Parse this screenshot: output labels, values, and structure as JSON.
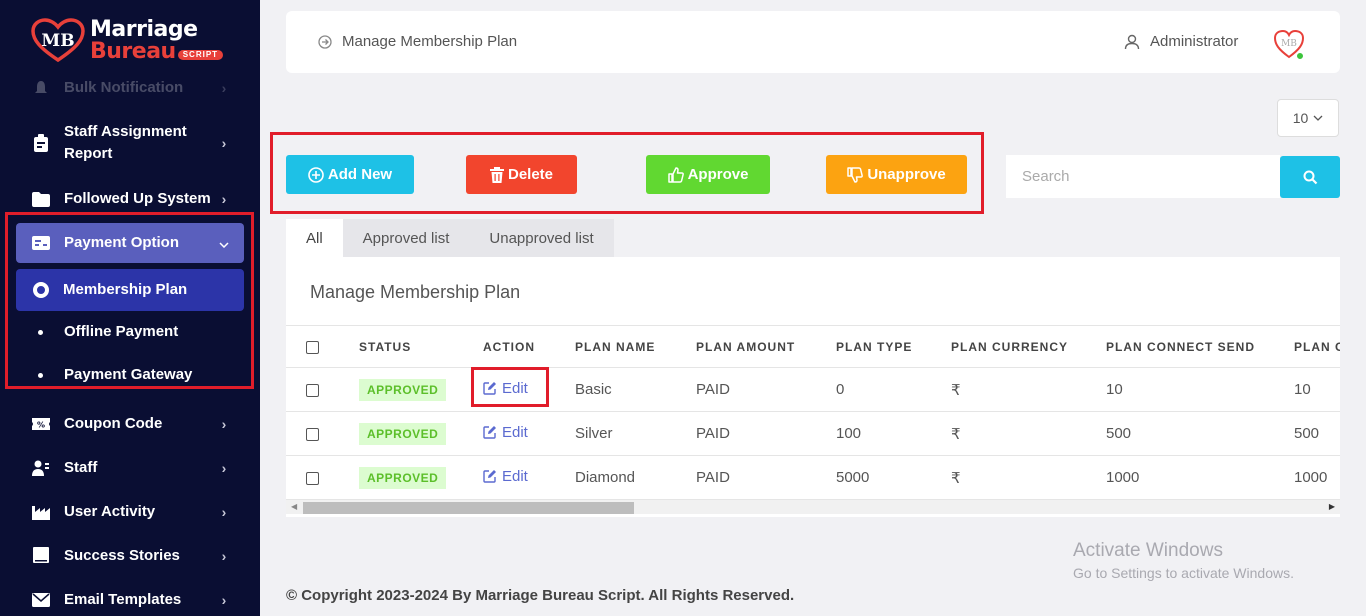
{
  "logo": {
    "line1": "Marriage",
    "line2": "Bureau",
    "tag": "SCRIPT",
    "mark": "MB"
  },
  "sidebar": {
    "items": [
      {
        "label": "Bulk Notification",
        "icon": "bell-icon"
      },
      {
        "label": "Staff Assignment Report",
        "icon": "clipboard-icon"
      },
      {
        "label": "Followed Up System",
        "icon": "folder-icon"
      },
      {
        "label": "Payment Option",
        "icon": "card-icon"
      },
      {
        "label": "Membership Plan",
        "icon": "radio-icon"
      },
      {
        "label": "Offline Payment",
        "icon": "dot-icon"
      },
      {
        "label": "Payment Gateway",
        "icon": "dot-icon"
      },
      {
        "label": "Coupon Code",
        "icon": "ticket-icon"
      },
      {
        "label": "Staff",
        "icon": "staff-icon"
      },
      {
        "label": "User Activity",
        "icon": "factory-icon"
      },
      {
        "label": "Success Stories",
        "icon": "book-icon"
      },
      {
        "label": "Email Templates",
        "icon": "envelope-icon"
      }
    ]
  },
  "header": {
    "title": "Manage Membership Plan",
    "user": "Administrator",
    "avatar": "MB"
  },
  "page_size": "10",
  "toolbar": {
    "add": "Add New",
    "delete": "Delete",
    "approve": "Approve",
    "unapprove": "Unapprove"
  },
  "search": {
    "placeholder": "Search"
  },
  "tabs": [
    "All",
    "Approved list",
    "Unapproved list"
  ],
  "card": {
    "title": "Manage Membership Plan"
  },
  "table": {
    "columns": [
      "STATUS",
      "ACTION",
      "PLAN NAME",
      "PLAN AMOUNT",
      "PLAN TYPE",
      "PLAN CURRENCY",
      "PLAN CONNECT SEND",
      "PLAN C"
    ],
    "rows": [
      {
        "status": "APPROVED",
        "action": "Edit",
        "name": "Basic",
        "amount": "PAID",
        "type": "0",
        "currency": "₹",
        "connect": "10",
        "extra": "10"
      },
      {
        "status": "APPROVED",
        "action": "Edit",
        "name": "Silver",
        "amount": "PAID",
        "type": "100",
        "currency": "₹",
        "connect": "500",
        "extra": "500"
      },
      {
        "status": "APPROVED",
        "action": "Edit",
        "name": "Diamond",
        "amount": "PAID",
        "type": "5000",
        "currency": "₹",
        "connect": "1000",
        "extra": "1000"
      }
    ]
  },
  "footer": "© Copyright 2023-2024 By Marriage Bureau Script. All Rights Reserved.",
  "watermark": {
    "line1": "Activate Windows",
    "line2": "Go to Settings to activate Windows."
  },
  "colors": {
    "sidebar": "#0a0e33",
    "accent": "#1ec1e6",
    "danger": "#f2452d",
    "success": "#61d831",
    "warning": "#fca311",
    "highlight": "#e11d2a"
  }
}
